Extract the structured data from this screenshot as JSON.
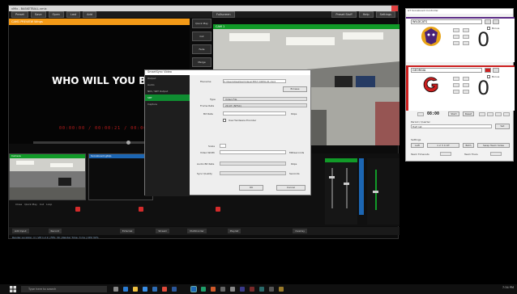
{
  "main_window": {
    "title": "vMix - BASKETBALL.vmix",
    "menu": [
      "Preset",
      "Save",
      "Open",
      "Last",
      "Add"
    ],
    "menu_mid": "Fullscreen",
    "menu_right": [
      "Preset Stuff",
      "Help",
      "Settings"
    ],
    "preview_label": "CAM1 PREVIEW Wings",
    "program_label": "CAM 1",
    "tagline": "WHO WILL YOU BE?",
    "timecodes": "00:00:00 / 00:00:21 / 00:00:00",
    "transitions": [
      "Quick Play",
      "Cut",
      "Fade",
      "Merge",
      "Wipe",
      "Slide"
    ],
    "inputs": [
      {
        "label": "Camera",
        "color": "#119a28"
      },
      {
        "label": "Scoreboard.gtzip",
        "color": "#1c66b3"
      }
    ],
    "bottom_bar": [
      "Add Input",
      "Record",
      "External",
      "Stream",
      "MultiCorder",
      "Playlist",
      "Overlay"
    ],
    "status": "Render Location: C:\\ VM 1.2 2   |   FPS: 30   |   Render Time: 3 ms   |   CPU 32%"
  },
  "dialog": {
    "title": "SmartSync Video",
    "side_items": [
      "Output",
      "Audio",
      "NDI / SRT Output",
      "SRT",
      "Capture"
    ],
    "active_side": 3,
    "field_filename_label": "Filename",
    "field_filename": "C:\\Users\\Desktop\\Videos\\TEST VIDEO-01.mp4",
    "browse": "Browse",
    "type_label": "Type",
    "type_value": "Video File",
    "frame_rate_label": "Frame Rate",
    "frame_rate_value": "29.97 (NTSC)",
    "bit_rate_label": "Bit Rate",
    "bit_rate_unit": "Kbps",
    "use_hardware": "Use Hardware Encoder",
    "scale_label": "Scale",
    "scale_value": "",
    "width_label": "Video Width",
    "width_unit": "Milliseconds",
    "audio_label": "Audio Bit Rate",
    "audio_unit": "Kbps",
    "quality_label": "Sync Quality",
    "quality_unit": "Seconds",
    "ok": "OK",
    "cancel": "Cancel"
  },
  "scoreboard": {
    "title": "GT Scoreboard Controller",
    "home": {
      "name": "WILDCATS",
      "score": "0",
      "color": "#5a2a84",
      "checkbox": "Bonus"
    },
    "away": {
      "name": "GEORGIA",
      "score": "0",
      "color": "#cc1f1f",
      "checkbox": "Bonus"
    },
    "clock": "08:00",
    "clock_buttons": [
      "Start",
      "Reset"
    ],
    "period_label": "Period / Quarter",
    "period_value": "Half 1st",
    "period_btn": "Set",
    "possession_label": "Settings",
    "possession_buttons": [
      "Left",
      "1 2 3 4 OT",
      "Both",
      "Swap Team Sides"
    ],
    "shot_clock_label": "Team Timeouts",
    "fouls_label": "Team Fouls"
  },
  "taskbar": {
    "search_placeholder": "Type here to search",
    "clock": "7:34 PM"
  },
  "colors": {
    "preview_orange": "#f39a17",
    "program_green": "#119a28",
    "home_purple": "#5a2a84",
    "away_red": "#cc1f1f"
  }
}
